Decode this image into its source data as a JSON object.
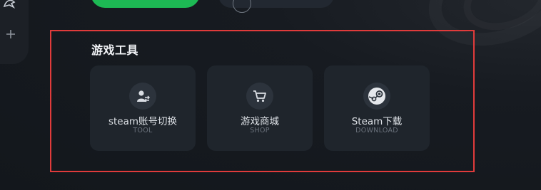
{
  "section": {
    "title": "游戏工具"
  },
  "tools": [
    {
      "title": "steam账号切换",
      "subtitle": "TOOL",
      "icon": "account-switch-icon"
    },
    {
      "title": "游戏商城",
      "subtitle": "SHOP",
      "icon": "shopping-cart-icon"
    },
    {
      "title": "Steam下载",
      "subtitle": "DOWNLOAD",
      "icon": "steam-logo-icon"
    }
  ],
  "colors": {
    "background": "#15191f",
    "card": "#1f252c",
    "accent_green": "#1db954",
    "highlight_border": "#e03b3b"
  }
}
